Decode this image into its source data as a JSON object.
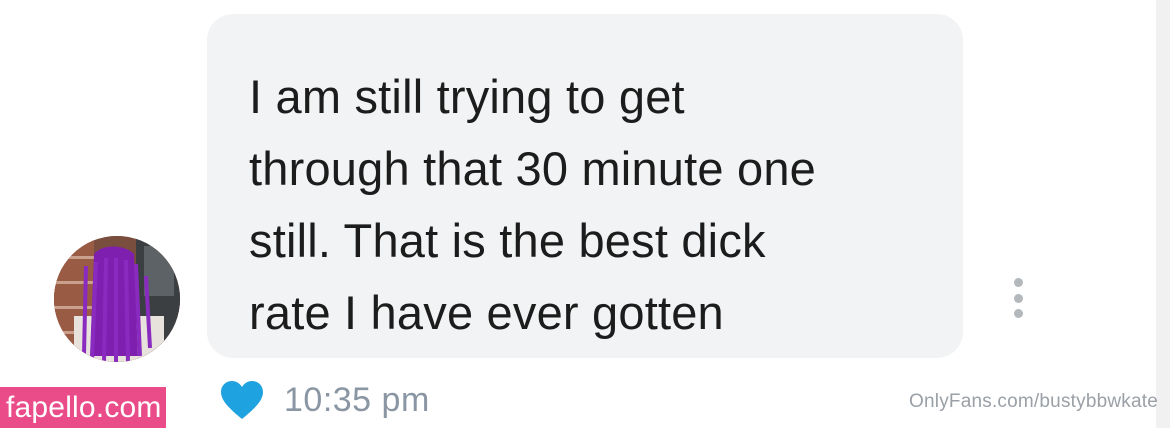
{
  "message": {
    "lines": [
      "I am still trying to get",
      "through that 30 minute one",
      "still. That is the best dick",
      "rate I have ever gotten"
    ],
    "time": "10:35 pm",
    "liked": true
  },
  "icons": {
    "avatar": "avatar-redacted",
    "more": "more-vertical-icon",
    "like": "heart-icon"
  },
  "colors": {
    "bubble": "#f1f3f4",
    "heart": "#1fa2e0",
    "time": "#8a96a3",
    "left_watermark_bg": "#ea4c89"
  },
  "watermarks": {
    "left": "fapello.com",
    "right": "OnlyFans.com/bustybbwkate"
  }
}
